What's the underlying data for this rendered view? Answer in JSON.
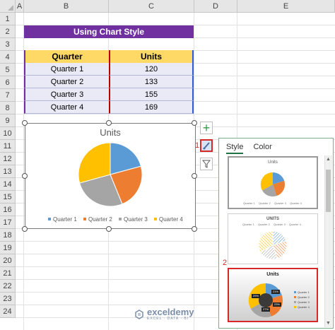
{
  "columns": [
    "A",
    "B",
    "C",
    "D",
    "E"
  ],
  "rows": [
    "1",
    "2",
    "3",
    "4",
    "5",
    "6",
    "7",
    "8",
    "9",
    "10",
    "11",
    "12",
    "13",
    "14",
    "15",
    "16",
    "17",
    "18",
    "19",
    "20",
    "21",
    "22",
    "23",
    "24"
  ],
  "sheet_title": "Using Chart Style",
  "table": {
    "headers": [
      "Quarter",
      "Units"
    ],
    "rows": [
      [
        "Quarter 1",
        "120"
      ],
      [
        "Quarter 2",
        "133"
      ],
      [
        "Quarter 3",
        "155"
      ],
      [
        "Quarter 4",
        "169"
      ]
    ]
  },
  "chart_data": {
    "type": "pie",
    "title": "Units",
    "categories": [
      "Quarter 1",
      "Quarter 2",
      "Quarter 3",
      "Quarter 4"
    ],
    "values": [
      120,
      133,
      155,
      169
    ],
    "colors": [
      "#5b9bd5",
      "#ed7d31",
      "#a5a5a5",
      "#ffc000"
    ],
    "legend": "bottom"
  },
  "side_buttons": [
    {
      "icon": "plus-icon"
    },
    {
      "icon": "brush-icon"
    },
    {
      "icon": "filter-icon"
    }
  ],
  "labels": {
    "step1": "1",
    "step2": "2"
  },
  "panel": {
    "tabs": [
      "Style",
      "Color"
    ],
    "thumbs": [
      {
        "title": "Units",
        "legend": [
          "Quarter 1",
          "Quarter 2",
          "Quarter 3",
          "Quarter 4"
        ]
      },
      {
        "title": "UNITS",
        "legend": [
          "Quarter 1",
          "Quarter 2",
          "Quarter 3",
          "Quarter 4"
        ]
      },
      {
        "title": "Units",
        "legend": [
          "Quarter 1",
          "Quarter 2",
          "Quarter 3",
          "Quarter 4"
        ],
        "slice_labels": [
          "21%",
          "23%",
          "27%",
          "29%"
        ]
      }
    ]
  },
  "watermark": {
    "name": "exceldemy",
    "tagline": "EXCEL · DATA · BI"
  }
}
